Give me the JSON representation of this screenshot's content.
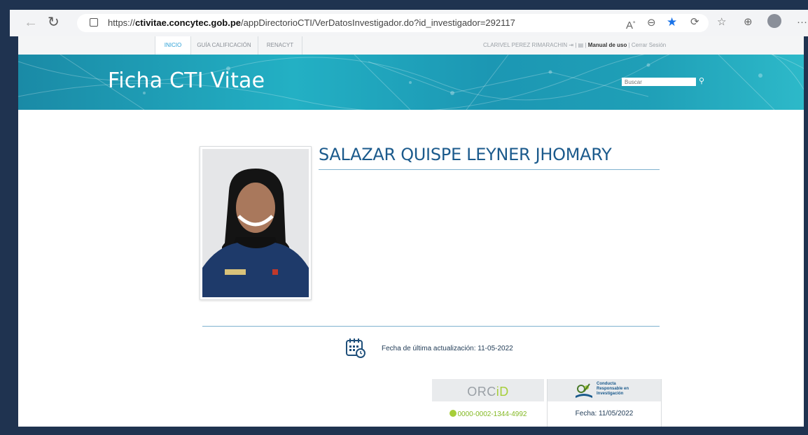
{
  "browser": {
    "url_prefix": "https://",
    "url_domain": "ctivitae.concytec.gob.pe",
    "url_path": "/appDirectorioCTI/VerDatosInvestigador.do?id_investigador=292117",
    "back_icon": "back-arrow-icon",
    "reload_icon": "reload-icon",
    "toolbar_icons": [
      "read-aloud-icon",
      "zoom-icon",
      "favorite-star-icon",
      "extensions-icon",
      "favorites-list-icon",
      "collections-icon",
      "profile-icon",
      "more-icon"
    ],
    "favorite_color": "#1a73e8"
  },
  "subnav": {
    "tabs": [
      "INICIO",
      "GUÍA CALIFICACIÓN",
      "RENACYT"
    ],
    "active_tab": "INICIO",
    "user_name": "CLARIVEL PEREZ RIMARACHIN",
    "manual_label": "Manual de uso",
    "logout_label": "Cerrar Sesión"
  },
  "banner": {
    "title": "Ficha CTI Vitae",
    "search_placeholder": "Buscar",
    "search_icon": "search-icon"
  },
  "profile": {
    "name": "SALAZAR QUISPE LEYNER JHOMARY"
  },
  "update": {
    "label": "Fecha de última actualización: 11-05-2022",
    "icon": "calendar-clock-icon"
  },
  "orcid": {
    "logo_text_a": "ORC",
    "logo_text_b": "iD",
    "id": "0000-0002-1344-4992"
  },
  "cri": {
    "label_line1": "Conducta",
    "label_line2": "Responsable en",
    "label_line3": "Investigación",
    "date": "Fecha:  11/05/2022"
  },
  "colors": {
    "accent": "#1b5a8c",
    "banner": "#23b0c4",
    "orcid_green": "#a6ce39"
  }
}
